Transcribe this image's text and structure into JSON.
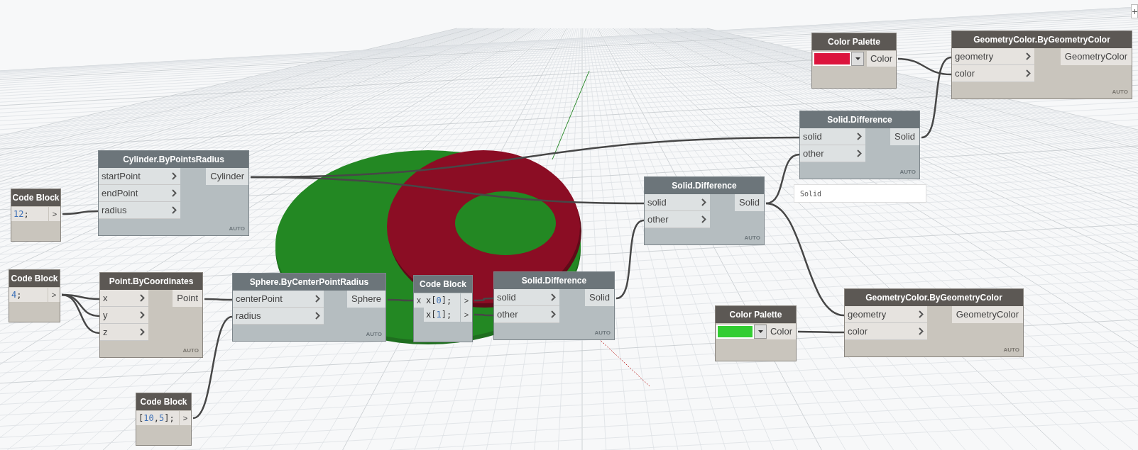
{
  "nodes": [
    {
      "kind": "color_palette",
      "title": "Color Palette",
      "preview": true,
      "color": "#dc143c",
      "outputs": [
        "Color"
      ]
    },
    {
      "kind": "function",
      "title": "GeometryColor.ByGeometryColor",
      "preview": true,
      "inputs": [
        "geometry",
        "color"
      ],
      "outputs": [
        "GeometryColor"
      ],
      "lacing": "AUTO"
    },
    {
      "kind": "function",
      "title": "Solid.Difference",
      "preview": false,
      "inputs": [
        "solid",
        "other"
      ],
      "outputs": [
        "Solid"
      ],
      "lacing": "AUTO",
      "tooltip": "Solid"
    },
    {
      "kind": "function",
      "title": "Cylinder.ByPointsRadius",
      "preview": false,
      "inputs": [
        "startPoint",
        "endPoint",
        "radius"
      ],
      "outputs": [
        "Cylinder"
      ],
      "lacing": "AUTO"
    },
    {
      "kind": "code_block",
      "title": "Code Block",
      "preview": true,
      "lines": [
        {
          "code": "12;",
          "output": ">"
        }
      ]
    },
    {
      "kind": "function",
      "title": "Solid.Difference",
      "preview": false,
      "inputs": [
        "solid",
        "other"
      ],
      "outputs": [
        "Solid"
      ],
      "lacing": "AUTO"
    },
    {
      "kind": "code_block",
      "title": "Code Block",
      "preview": true,
      "lines": [
        {
          "code": "4;",
          "output": ">"
        }
      ]
    },
    {
      "kind": "function",
      "title": "Point.ByCoordinates",
      "preview": true,
      "inputs": [
        "x",
        "y",
        "z"
      ],
      "outputs": [
        "Point"
      ],
      "lacing": "AUTO"
    },
    {
      "kind": "function",
      "title": "Sphere.ByCenterPointRadius",
      "preview": false,
      "inputs": [
        "centerPoint",
        "radius"
      ],
      "outputs": [
        "Sphere"
      ],
      "lacing": "AUTO"
    },
    {
      "kind": "code_block",
      "title": "Code Block",
      "preview": false,
      "inputs": [
        "x"
      ],
      "lines": [
        {
          "code": "x[0];",
          "output": ">"
        },
        {
          "code": "x[1];",
          "output": ">"
        }
      ]
    },
    {
      "kind": "function",
      "title": "Solid.Difference",
      "preview": false,
      "inputs": [
        "solid",
        "other"
      ],
      "outputs": [
        "Solid"
      ],
      "lacing": "AUTO"
    },
    {
      "kind": "color_palette",
      "title": "Color Palette",
      "preview": true,
      "color": "#32cd32",
      "outputs": [
        "Color"
      ]
    },
    {
      "kind": "function",
      "title": "GeometryColor.ByGeometryColor",
      "preview": true,
      "inputs": [
        "geometry",
        "color"
      ],
      "outputs": [
        "GeometryColor"
      ],
      "lacing": "AUTO"
    },
    {
      "kind": "code_block",
      "title": "Code Block",
      "preview": true,
      "lines": [
        {
          "code": "[10,5];",
          "output": ">"
        }
      ]
    }
  ]
}
